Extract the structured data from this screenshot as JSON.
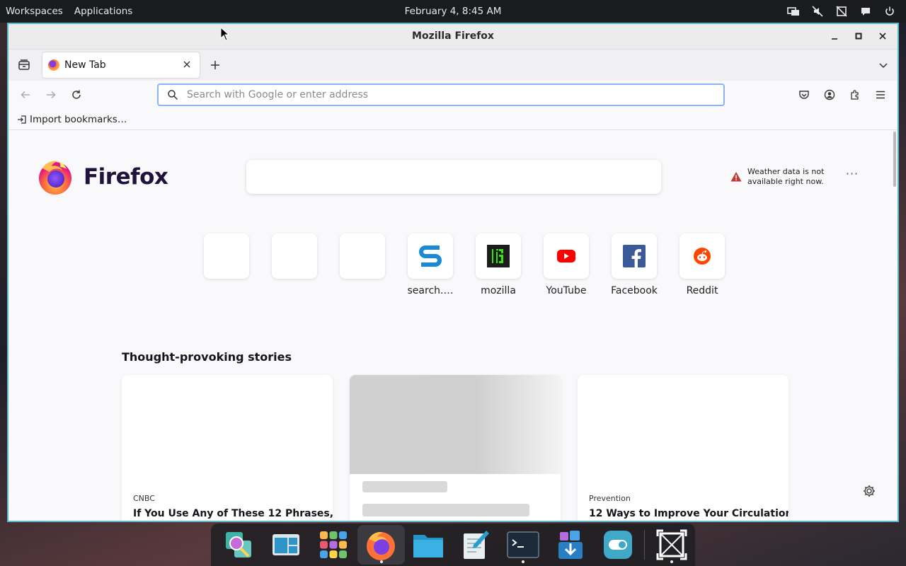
{
  "topbar": {
    "workspaces": "Workspaces",
    "applications": "Applications",
    "clock": "February 4,  8:45 AM",
    "tray_icons": [
      "display-icon",
      "mute-icon",
      "network-off-icon",
      "chat-icon",
      "power-icon"
    ]
  },
  "window": {
    "title": "Mozilla Firefox",
    "controls": [
      "minimize-icon",
      "maximize-icon",
      "close-icon"
    ]
  },
  "tabs": {
    "active_tab_label": "New Tab"
  },
  "navbar": {
    "url_placeholder": "Search with Google or enter address"
  },
  "bookmarks": {
    "import_label": "Import bookmarks…"
  },
  "newtab": {
    "brand": "Firefox",
    "weather_text": "Weather data is not available right now.",
    "shortcuts": [
      {
        "label": "",
        "icon": "empty"
      },
      {
        "label": "",
        "icon": "empty"
      },
      {
        "label": "",
        "icon": "empty"
      },
      {
        "label": "search.…",
        "icon": "search-s-icon"
      },
      {
        "label": "mozilla",
        "icon": "mozilla-m-icon"
      },
      {
        "label": "YouTube",
        "icon": "youtube-icon"
      },
      {
        "label": "Facebook",
        "icon": "facebook-icon"
      },
      {
        "label": "Reddit",
        "icon": "reddit-icon"
      }
    ],
    "stories_title": "Thought-provoking stories",
    "stories": [
      {
        "source": "CNBC",
        "headline": "If You Use Any of These 12 Phrases,"
      },
      {
        "source": "",
        "headline": ""
      },
      {
        "source": "Prevention",
        "headline": "12 Ways to Improve Your Circulation"
      }
    ]
  },
  "dock": {
    "apps": [
      "search-app-icon",
      "workspace-app-icon",
      "app-grid-icon",
      "firefox-icon",
      "files-icon",
      "text-editor-icon",
      "terminal-icon",
      "download-manager-icon",
      "toggle-settings-icon",
      "screenshot-tool-icon"
    ]
  },
  "colors": {
    "window_border": "#5fb8c7",
    "url_focus": "#8cb4f0",
    "topbar_bg": "#1a1b1e"
  }
}
